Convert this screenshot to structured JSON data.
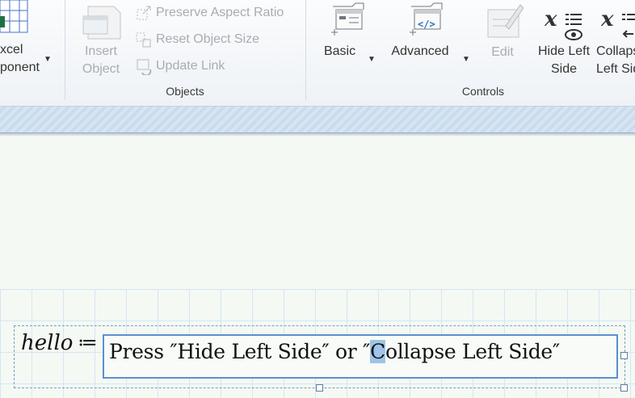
{
  "ribbon": {
    "excel_component": {
      "label_line1": "xcel",
      "label_line2": "ponent"
    },
    "insert_object": {
      "label_line1": "Insert",
      "label_line2": "Object"
    },
    "preserve_aspect_ratio": "Preserve Aspect Ratio",
    "reset_object_size": "Reset Object Size",
    "update_link": "Update Link",
    "objects_group": "Objects",
    "basic": "Basic",
    "advanced": "Advanced",
    "edit": "Edit",
    "hide_left_side": {
      "label_line1": "Hide Left",
      "label_line2": "Side"
    },
    "collapse_left_side": {
      "label_line1": "Collaps",
      "label_line2": "Left Sid"
    },
    "controls_group": "Controls"
  },
  "worksheet": {
    "variable_name": "hello",
    "assign_operator": "≔",
    "string_before": "Press ″Hide Left Side″ or ″",
    "string_selected": "C",
    "string_after": "ollapse Left Side″"
  },
  "colors": {
    "accent": "#5b8fd0",
    "selection": "#9fc4e8",
    "grid": "#d5e6f2"
  }
}
